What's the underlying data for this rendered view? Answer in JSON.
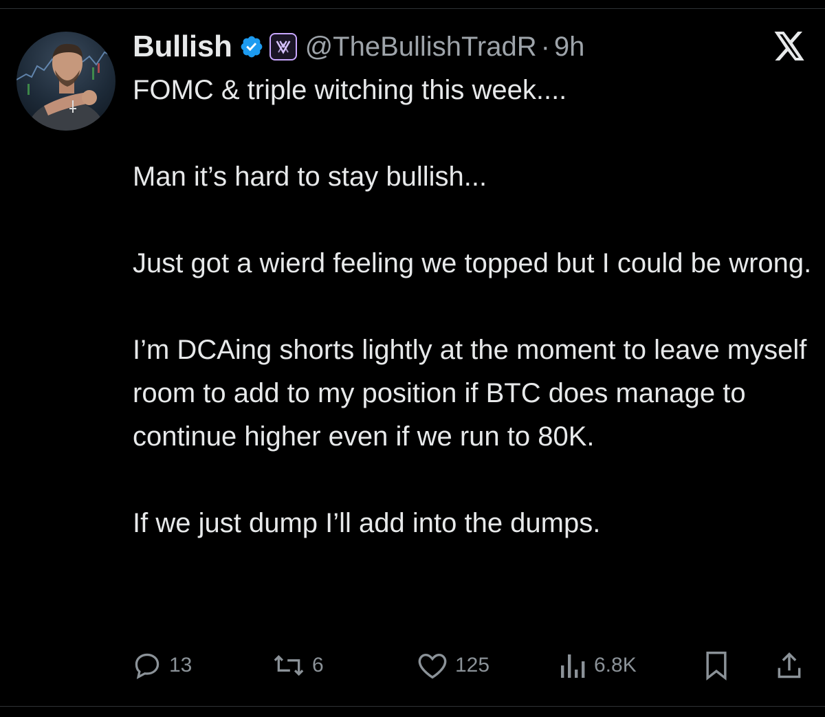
{
  "author": {
    "display_name": "Bullish",
    "verified_icon": "verified-badge-icon",
    "affiliate_icon": "affiliate-badge-icon",
    "handle": "@TheBullishTradR",
    "separator": "·",
    "time": "9h"
  },
  "brand": {
    "logo_icon": "x-logo-icon"
  },
  "tweet": {
    "paragraphs": [
      "FOMC & triple witching this week....",
      "Man it’s hard to stay bullish...",
      "Just got a wierd feeling we topped but I could be wrong.",
      "I’m DCAing shorts lightly at the moment to leave myself room to add to my position if BTC does manage to continue higher even if we run to 80K.",
      "If we just dump I’ll add into the dumps."
    ]
  },
  "actions": {
    "replies": {
      "icon": "reply-icon",
      "count": "13"
    },
    "reposts": {
      "icon": "repost-icon",
      "count": "6"
    },
    "likes": {
      "icon": "heart-icon",
      "count": "125"
    },
    "views": {
      "icon": "views-icon",
      "count": "6.8K"
    },
    "bookmark": {
      "icon": "bookmark-icon"
    },
    "share": {
      "icon": "share-icon"
    }
  },
  "colors": {
    "background": "#000000",
    "text": "#e7e9ea",
    "muted": "#8b9298",
    "verified": "#1d9bf0",
    "divider": "#2f3336"
  }
}
